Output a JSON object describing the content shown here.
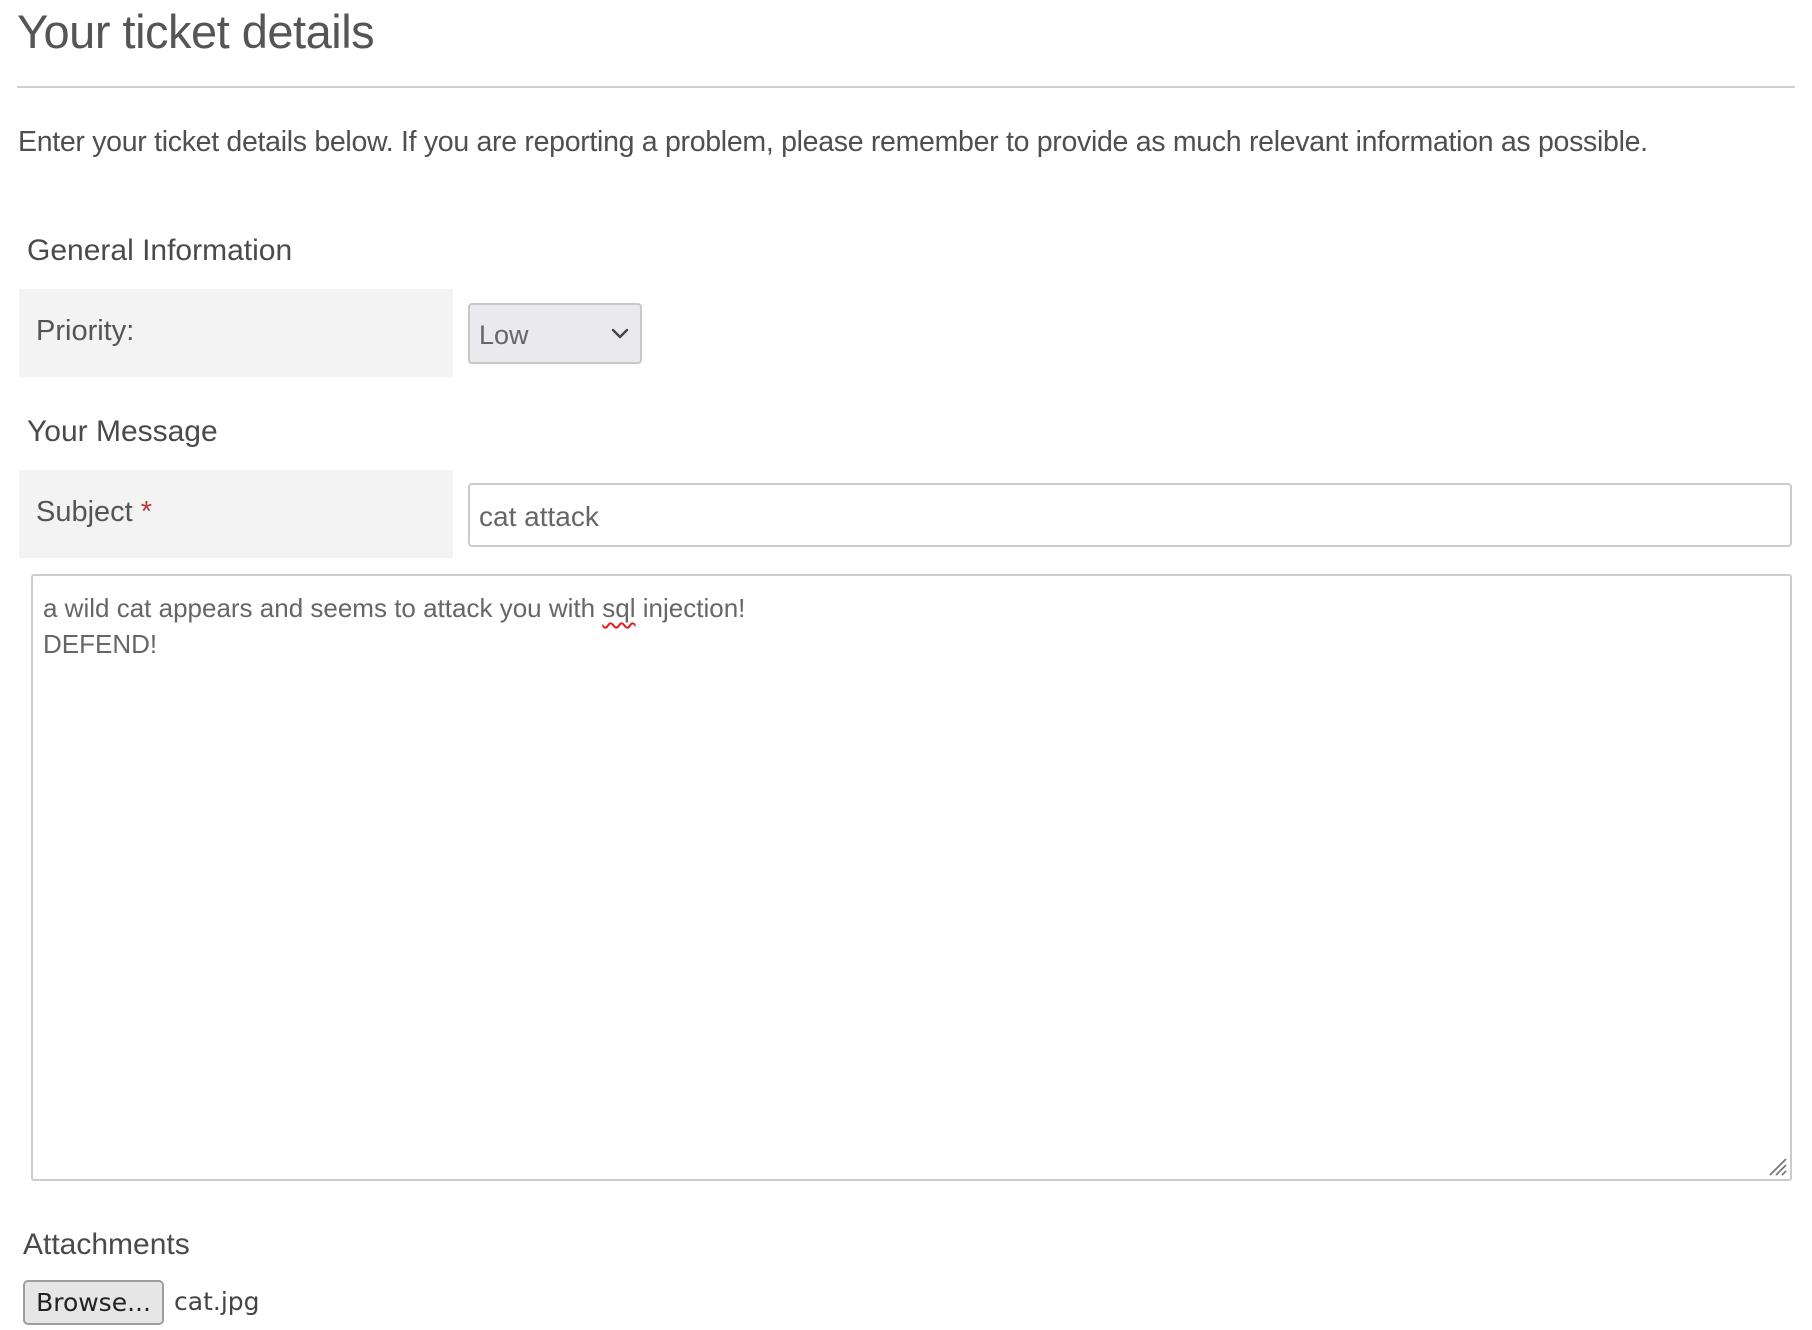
{
  "page": {
    "title": "Your ticket details",
    "intro": "Enter your ticket details below. If you are reporting a problem, please remember to provide as much relevant information as possible."
  },
  "general_information": {
    "heading": "General Information",
    "priority": {
      "label": "Priority:",
      "selected": "Low",
      "icon": "chevron-down-icon"
    }
  },
  "your_message": {
    "heading": "Your Message",
    "subject": {
      "label": "Subject",
      "required_marker": "*",
      "value": "cat attack"
    },
    "message": {
      "line1_before": "a wild cat appears and seems to attack you with ",
      "line1_misspelled": "sql",
      "line1_after": " injection!",
      "line2": "DEFEND!"
    }
  },
  "attachments": {
    "heading": "Attachments",
    "browse_label": "Browse...",
    "file_name": "cat.jpg"
  },
  "colors": {
    "required": "#b03a3a",
    "label_background": "#f3f3f3",
    "select_background": "#e9e9ee",
    "spellcheck": "#e02020"
  }
}
